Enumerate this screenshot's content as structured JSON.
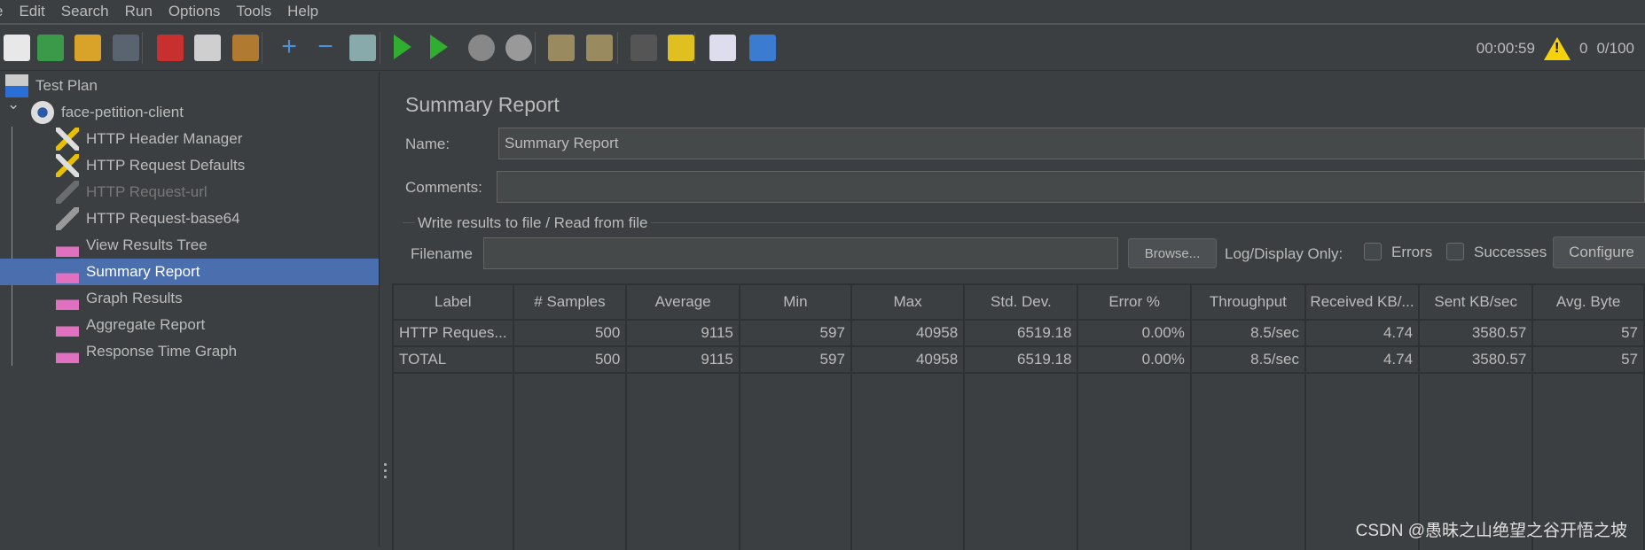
{
  "menu": [
    "e",
    "Edit",
    "Search",
    "Run",
    "Options",
    "Tools",
    "Help"
  ],
  "toolbar": {
    "icons": [
      "new-icon",
      "templates-icon",
      "open-icon",
      "save-icon",
      "cut-icon",
      "copy-icon",
      "paste-icon",
      "expand-icon",
      "collapse-icon",
      "toggle-icon",
      "start-icon",
      "start-no-pause-icon",
      "stop-icon",
      "shutdown-icon",
      "clear-icon",
      "clear-all-icon",
      "search-icon",
      "reset-search-icon",
      "function-helper-icon",
      "help-icon"
    ],
    "elapsed": "00:00:59",
    "warnings": "0",
    "threads": "0/100"
  },
  "tree": [
    {
      "label": "Test Plan",
      "icon": "flask-icon",
      "level": 0
    },
    {
      "label": "face-petition-client",
      "icon": "gear-icon",
      "level": 1
    },
    {
      "label": "HTTP Header Manager",
      "icon": "tools-icon",
      "level": 2
    },
    {
      "label": "HTTP Request Defaults",
      "icon": "tools-icon",
      "level": 2
    },
    {
      "label": "HTTP Request-url",
      "icon": "pipette-icon",
      "level": 2,
      "disabled": true
    },
    {
      "label": "HTTP Request-base64",
      "icon": "pipette-icon",
      "level": 2
    },
    {
      "label": "View Results Tree",
      "icon": "listener-icon",
      "level": 2
    },
    {
      "label": "Summary Report",
      "icon": "listener-icon",
      "level": 2,
      "selected": true
    },
    {
      "label": "Graph Results",
      "icon": "listener-icon",
      "level": 2
    },
    {
      "label": "Aggregate Report",
      "icon": "listener-icon",
      "level": 2
    },
    {
      "label": "Response Time Graph",
      "icon": "listener-icon",
      "level": 2
    }
  ],
  "panel": {
    "title": "Summary Report",
    "name_label": "Name:",
    "name_value": "Summary Report",
    "comments_label": "Comments:",
    "comments_value": "",
    "file_group": "Write results to file / Read from file",
    "filename_label": "Filename",
    "filename_value": "",
    "browse": "Browse...",
    "log_only": "Log/Display Only:",
    "errors": "Errors",
    "successes": "Successes",
    "configure": "Configure"
  },
  "table": {
    "columns": [
      "Label",
      "# Samples",
      "Average",
      "Min",
      "Max",
      "Std. Dev.",
      "Error %",
      "Throughput",
      "Received KB/...",
      "Sent KB/sec",
      "Avg. Byte"
    ],
    "rows": [
      [
        "HTTP Reques...",
        "500",
        "9115",
        "597",
        "40958",
        "6519.18",
        "0.00%",
        "8.5/sec",
        "4.74",
        "3580.57",
        "57"
      ],
      [
        "TOTAL",
        "500",
        "9115",
        "597",
        "40958",
        "6519.18",
        "0.00%",
        "8.5/sec",
        "4.74",
        "3580.57",
        "57"
      ]
    ]
  },
  "watermark": "CSDN @愚昧之山绝望之谷开悟之坡",
  "colors": {
    "background": "#3c3f41",
    "selection": "#4b6eaf",
    "input": "#45494a",
    "text": "#bbbbbb"
  }
}
